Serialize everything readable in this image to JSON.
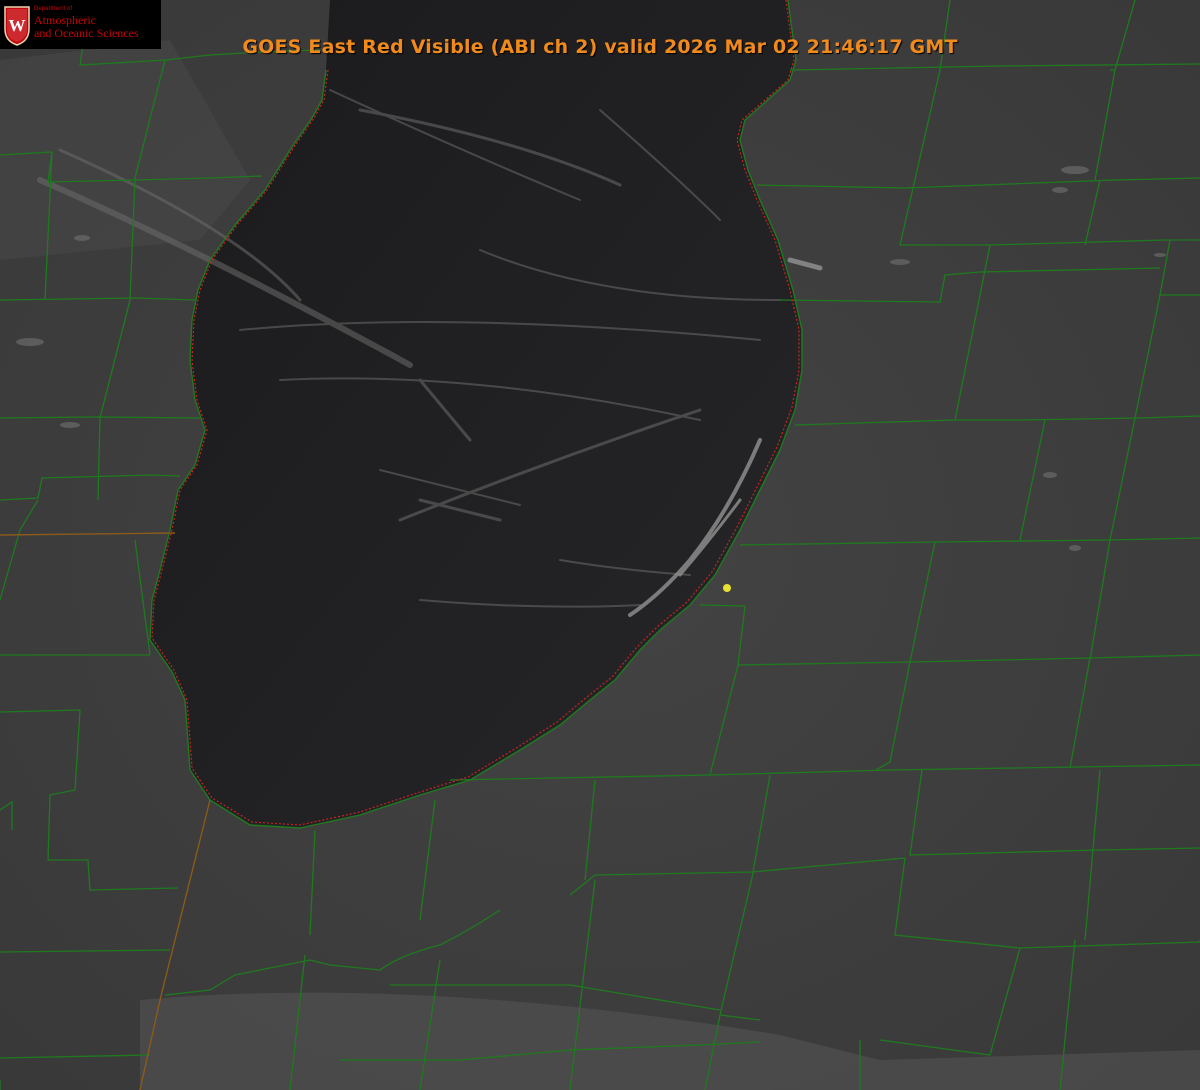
{
  "header": {
    "title": "GOES East Red Visible (ABI ch 2) valid 2026 Mar 02 21:46:17 GMT"
  },
  "logo": {
    "department": "Department of",
    "line1": "Atmospheric",
    "line2": "and Oceanic Sciences",
    "crest_letter": "W"
  },
  "map": {
    "lake_color": "#222224",
    "land_color": "#3f3f3f",
    "boundary_color": "#1f7a1f",
    "state_line_color": "#8a5a1a",
    "shoreline_color": "#cc2222",
    "marker_color": "#e8e030"
  }
}
